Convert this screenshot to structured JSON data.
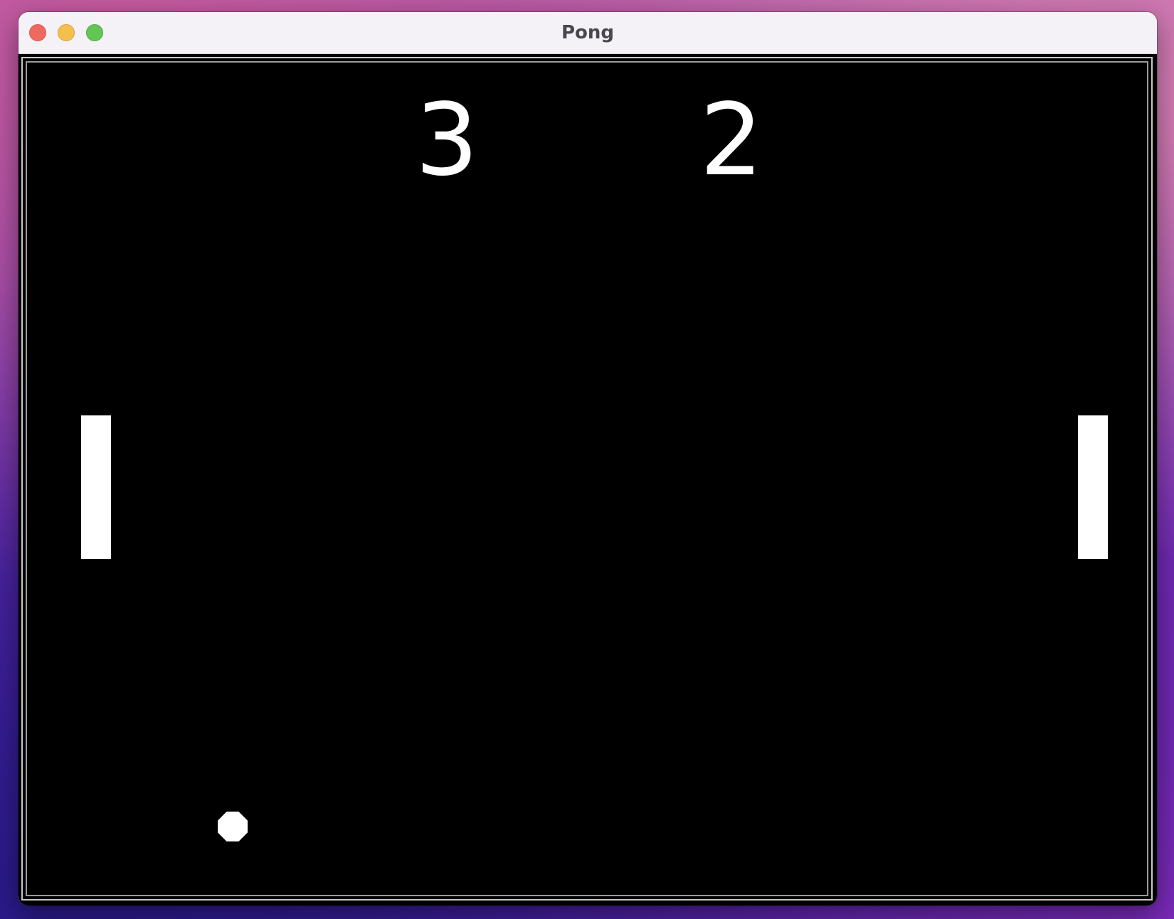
{
  "window": {
    "title": "Pong"
  },
  "game": {
    "score_left": "3",
    "score_right": "2"
  },
  "colors": {
    "court_background": "#000000",
    "foreground": "#ffffff"
  },
  "icons": {
    "close": "close-button",
    "minimize": "minimize-button",
    "maximize": "maximize-button"
  }
}
